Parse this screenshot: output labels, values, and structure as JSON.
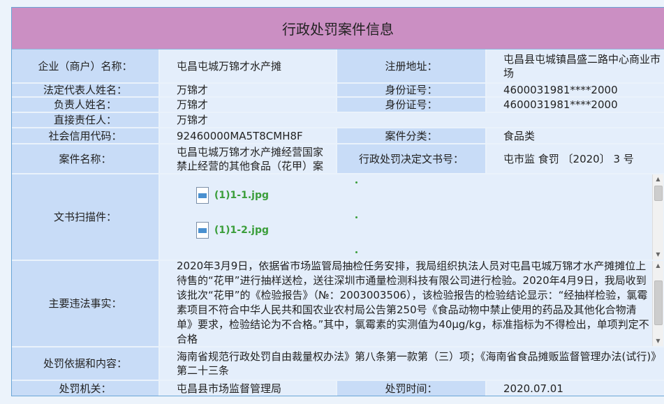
{
  "title": "行政处罚案件信息",
  "rows": {
    "enterprise_label": "企业（商户）名称：",
    "enterprise_value": "屯昌屯城万锦才水产摊",
    "reg_addr_label": "注册地址：",
    "reg_addr_value": "屯昌县屯城镇昌盛二路中心商业市场",
    "legal_rep_label": "法定代表人姓名：",
    "legal_rep_value": "万锦才",
    "id1_label": "身份证号：",
    "id1_value": "4600031981****2000",
    "principal_label": "负责人姓名：",
    "principal_value": "万锦才",
    "id2_label": "身份证号：",
    "id2_value": "4600031981****2000",
    "direct_label": "直接责任人：",
    "direct_value": "万锦才",
    "credit_label": "社会信用代码：",
    "credit_value": "92460000MA5T8CMH8F",
    "category_label": "案件分类：",
    "category_value": "食品类",
    "case_name_label": "案件名称：",
    "case_name_value": "屯昌屯城万锦才水产摊经营国家禁止经营的其他食品（花甲）案",
    "decision_no_label": "行政处罚决定文书号：",
    "decision_no_value": "屯市监 食罚 〔2020〕 3 号",
    "scan_label": "文书扫描件：",
    "files": [
      "(1)1-1.jpg",
      "(1)1-2.jpg"
    ],
    "facts_label": "主要违法事实：",
    "facts_value": "2020年3月9日，依据省市场监管局抽检任务安排，我局组织执法人员对屯昌屯城万锦才水产摊摊位上待售的“花甲”进行抽样送检，送往深圳市通量检测科技有限公司进行检验。2020年4月9日，我局收到该批次“花甲”的《检验报告》（№：2003003506），该检验报告的检验结论显示：“经抽样检验，氯霉素项目不符合中华人民共和国农业农村局公告第250号《食品动物中禁止使用的药品及其他化合物清单》要求，检验结论为不合格。”其中，氯霉素的实测值为40μg/kg，标准指标为不得检出，单项判定不合格",
    "basis_label": "处罚依据和内容：",
    "basis_value": "海南省规范行政处罚自由裁量权办法》第八条第一款第（三）项；《海南省食品摊贩监督管理办法(试行)》第二十三条",
    "authority_label": "处罚机关：",
    "authority_value": "屯昌县市场监督管理局",
    "time_label": "处罚时间：",
    "time_value": "2020.07.01"
  },
  "icons": {
    "file": "image-file-icon",
    "scroll_up": "scroll-up-arrow-icon",
    "scroll_down": "scroll-down-arrow-icon"
  },
  "colors": {
    "header": "#cb8fc3",
    "label_bg": "#c8dcf7",
    "value_bg": "#e4eefb",
    "link": "#3b9e3b"
  }
}
